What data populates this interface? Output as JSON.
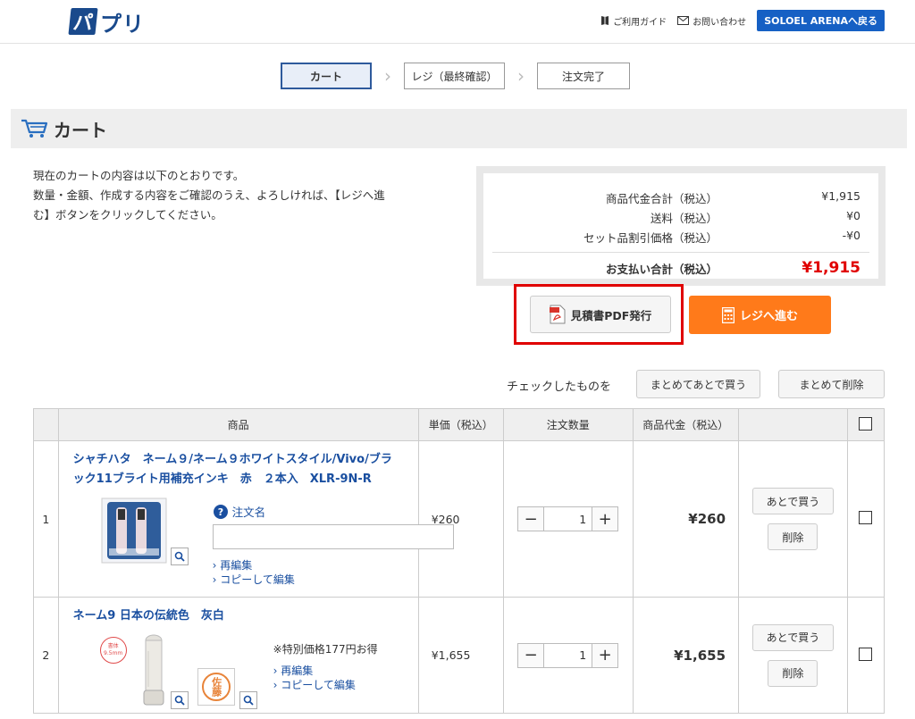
{
  "header": {
    "logo_mark": "パ",
    "logo_text": "プリ",
    "guide_label": "ご利用ガイド",
    "contact_label": "お問い合わせ",
    "return_label": "SOLOEL ARENAへ戻る"
  },
  "steps": [
    "カート",
    "レジ（最終確認）",
    "注文完了"
  ],
  "page_title": "カート",
  "intro": {
    "line1": "現在のカートの内容は以下のとおりです。",
    "line2": "数量・金額、作成する内容をご確認のうえ、よろしければ、【レジへ進",
    "line3": "む】ボタンをクリックしてください。"
  },
  "summary": {
    "subtotal_label": "商品代金合計（税込）",
    "subtotal_value": "¥1,915",
    "shipping_label": "送料（税込）",
    "shipping_value": "¥0",
    "discount_label": "セット品割引価格（税込）",
    "discount_value": "-¥0",
    "total_label": "お支払い合計（税込）",
    "total_value": "¥1,915"
  },
  "actions": {
    "pdf_label": "見積書PDF発行",
    "register_label": "レジへ進む"
  },
  "bulk": {
    "label": "チェックしたものを",
    "later_label": "まとめてあとで買う",
    "delete_label": "まとめて削除"
  },
  "table": {
    "headers": {
      "product": "商品",
      "unit_price": "単価（税込）",
      "qty": "注文数量",
      "subtotal": "商品代金（税込）"
    },
    "rows": [
      {
        "index": "1",
        "name_line1": "シャチハタ　ネーム９/ネーム９ホワイトスタイル/Vivo/ブラ",
        "name_line2": "ック11ブライト用補充インキ　赤　２本入　XLR-9N-R",
        "order_name_label": "注文名",
        "order_name_value": "",
        "reedit": "再編集",
        "copy_edit": "コピーして編集",
        "unit_price": "¥260",
        "qty": "1",
        "subtotal": "¥260",
        "later": "あとで買う",
        "delete": "削除"
      },
      {
        "index": "2",
        "name_line1": "ネーム9 日本の伝統色　灰白",
        "note": "※特別価格177円お得",
        "reedit": "再編集",
        "copy_edit": "コピーして編集",
        "stamp_text": "佐藤",
        "badge_text": "書体 9.5mm",
        "unit_price": "¥1,655",
        "qty": "1",
        "subtotal": "¥1,655",
        "later": "あとで買う",
        "delete": "削除"
      }
    ]
  }
}
